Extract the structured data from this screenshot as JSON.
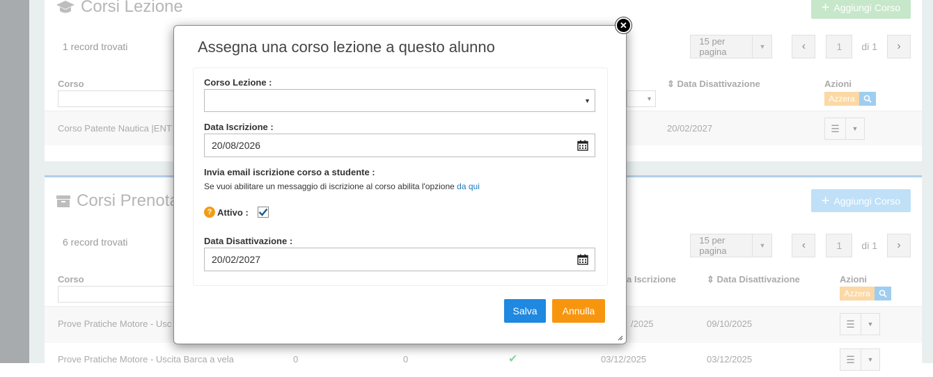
{
  "panel1": {
    "title": "Corsi Lezione",
    "add_button": "Aggiungi Corso",
    "records": "1 record trovati",
    "per_page": "15 per pagina",
    "page": "1",
    "page_of": "di 1",
    "columns": {
      "corso": "Corso",
      "data_disattivazione": "Data Disattivazione",
      "azioni": "Azioni"
    },
    "azzera": "Azzera",
    "rows": [
      {
        "corso": "Corso Patente Nautica |ENT",
        "data_disattivazione": "20/02/2027"
      }
    ]
  },
  "panel2": {
    "title": "Corsi Prenota",
    "add_button": "Aggiungi Corso",
    "records": "6 record trovati",
    "per_page": "15 per pagina",
    "page": "1",
    "page_of": "di 1",
    "columns": {
      "corso": "Corso",
      "data_iscrizione": "a Iscrizione",
      "data_disattivazione": "Data Disattivazione",
      "azioni": "Azioni"
    },
    "azzera": "Azzera",
    "rows": [
      {
        "corso": "Prove Pratiche Motore - Usc",
        "data_iscrizione": "/2025",
        "data_disattivazione": "09/10/2025"
      },
      {
        "corso": "Prove Pratiche Motore - Uscita Barca a vela",
        "col2": "0",
        "col3": "0",
        "data_iscrizione": "03/12/2025",
        "data_disattivazione": "03/12/2025"
      }
    ]
  },
  "modal": {
    "title": "Assegna una corso lezione a questo alunno",
    "close_symbol": "✕",
    "corso_label": "Corso Lezione :",
    "corso_value": "",
    "data_iscrizione_label": "Data Iscrizione :",
    "data_iscrizione_value": "20/08/2026",
    "email_label": "Invia email iscrizione corso a studente :",
    "email_note": "Se vuoi abilitare un messaggio di iscrizione al corso abilita l'opzione",
    "email_link": "da qui",
    "attivo_label": "Attivo :",
    "attivo_checked": true,
    "data_disattivazione_label": "Data Disattivazione :",
    "data_disattivazione_value": "20/02/2027",
    "save_label": "Salva",
    "cancel_label": "Annulla"
  },
  "icons": {
    "panel1_title": "graduation-cap-icon",
    "panel2_title": "archive-box-icon",
    "calendar": "calendar-icon",
    "help": "question-circle-icon"
  },
  "colors": {
    "save": "#1f88e0",
    "cancel": "#f7960e",
    "help": "#f29b18",
    "link": "#1a7bbf"
  }
}
